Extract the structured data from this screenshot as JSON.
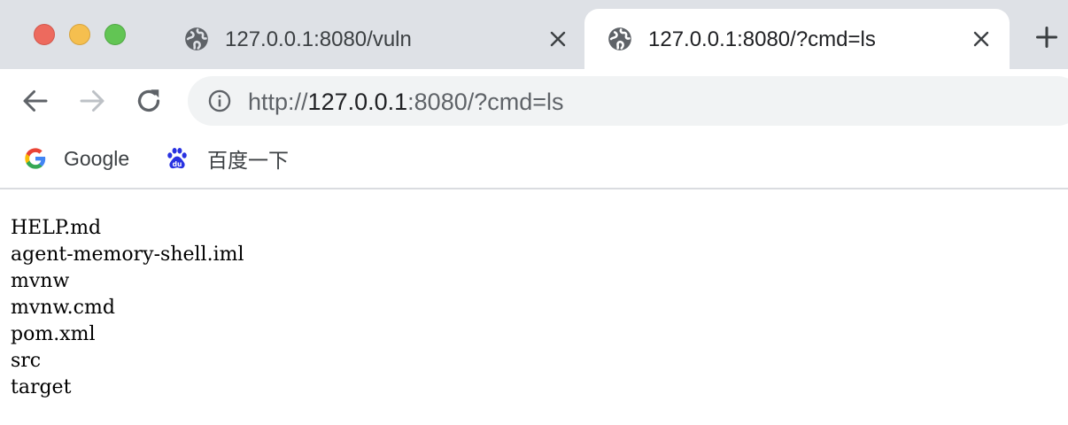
{
  "window": {
    "traffic_lights": {
      "close_color": "#ed6a5e",
      "minimize_color": "#f5bf4f",
      "maximize_color": "#62c554"
    }
  },
  "tabs": [
    {
      "title": "127.0.0.1:8080/vuln",
      "icon": "globe-icon",
      "active": false
    },
    {
      "title": "127.0.0.1:8080/?cmd=ls",
      "icon": "globe-icon",
      "active": true
    }
  ],
  "new_tab_icon": "plus-icon",
  "toolbar": {
    "back_icon": "arrow-left-icon",
    "forward_icon": "arrow-right-icon",
    "reload_icon": "reload-icon",
    "site_info_icon": "info-icon",
    "url": {
      "scheme": "http://",
      "host": "127.0.0.1",
      "rest": ":8080/?cmd=ls"
    }
  },
  "bookmarks": [
    {
      "label": "Google",
      "icon": "google-g-icon"
    },
    {
      "label": "百度一下",
      "icon": "baidu-paw-icon"
    }
  ],
  "content": {
    "lines": [
      "HELP.md",
      "agent-memory-shell.iml",
      "mvnw",
      "mvnw.cmd",
      "pom.xml",
      "src",
      "target"
    ]
  },
  "colors": {
    "tabstrip_bg": "#dee1e6",
    "omnibox_bg": "#f1f3f4",
    "baidu_blue": "#2932e1"
  }
}
